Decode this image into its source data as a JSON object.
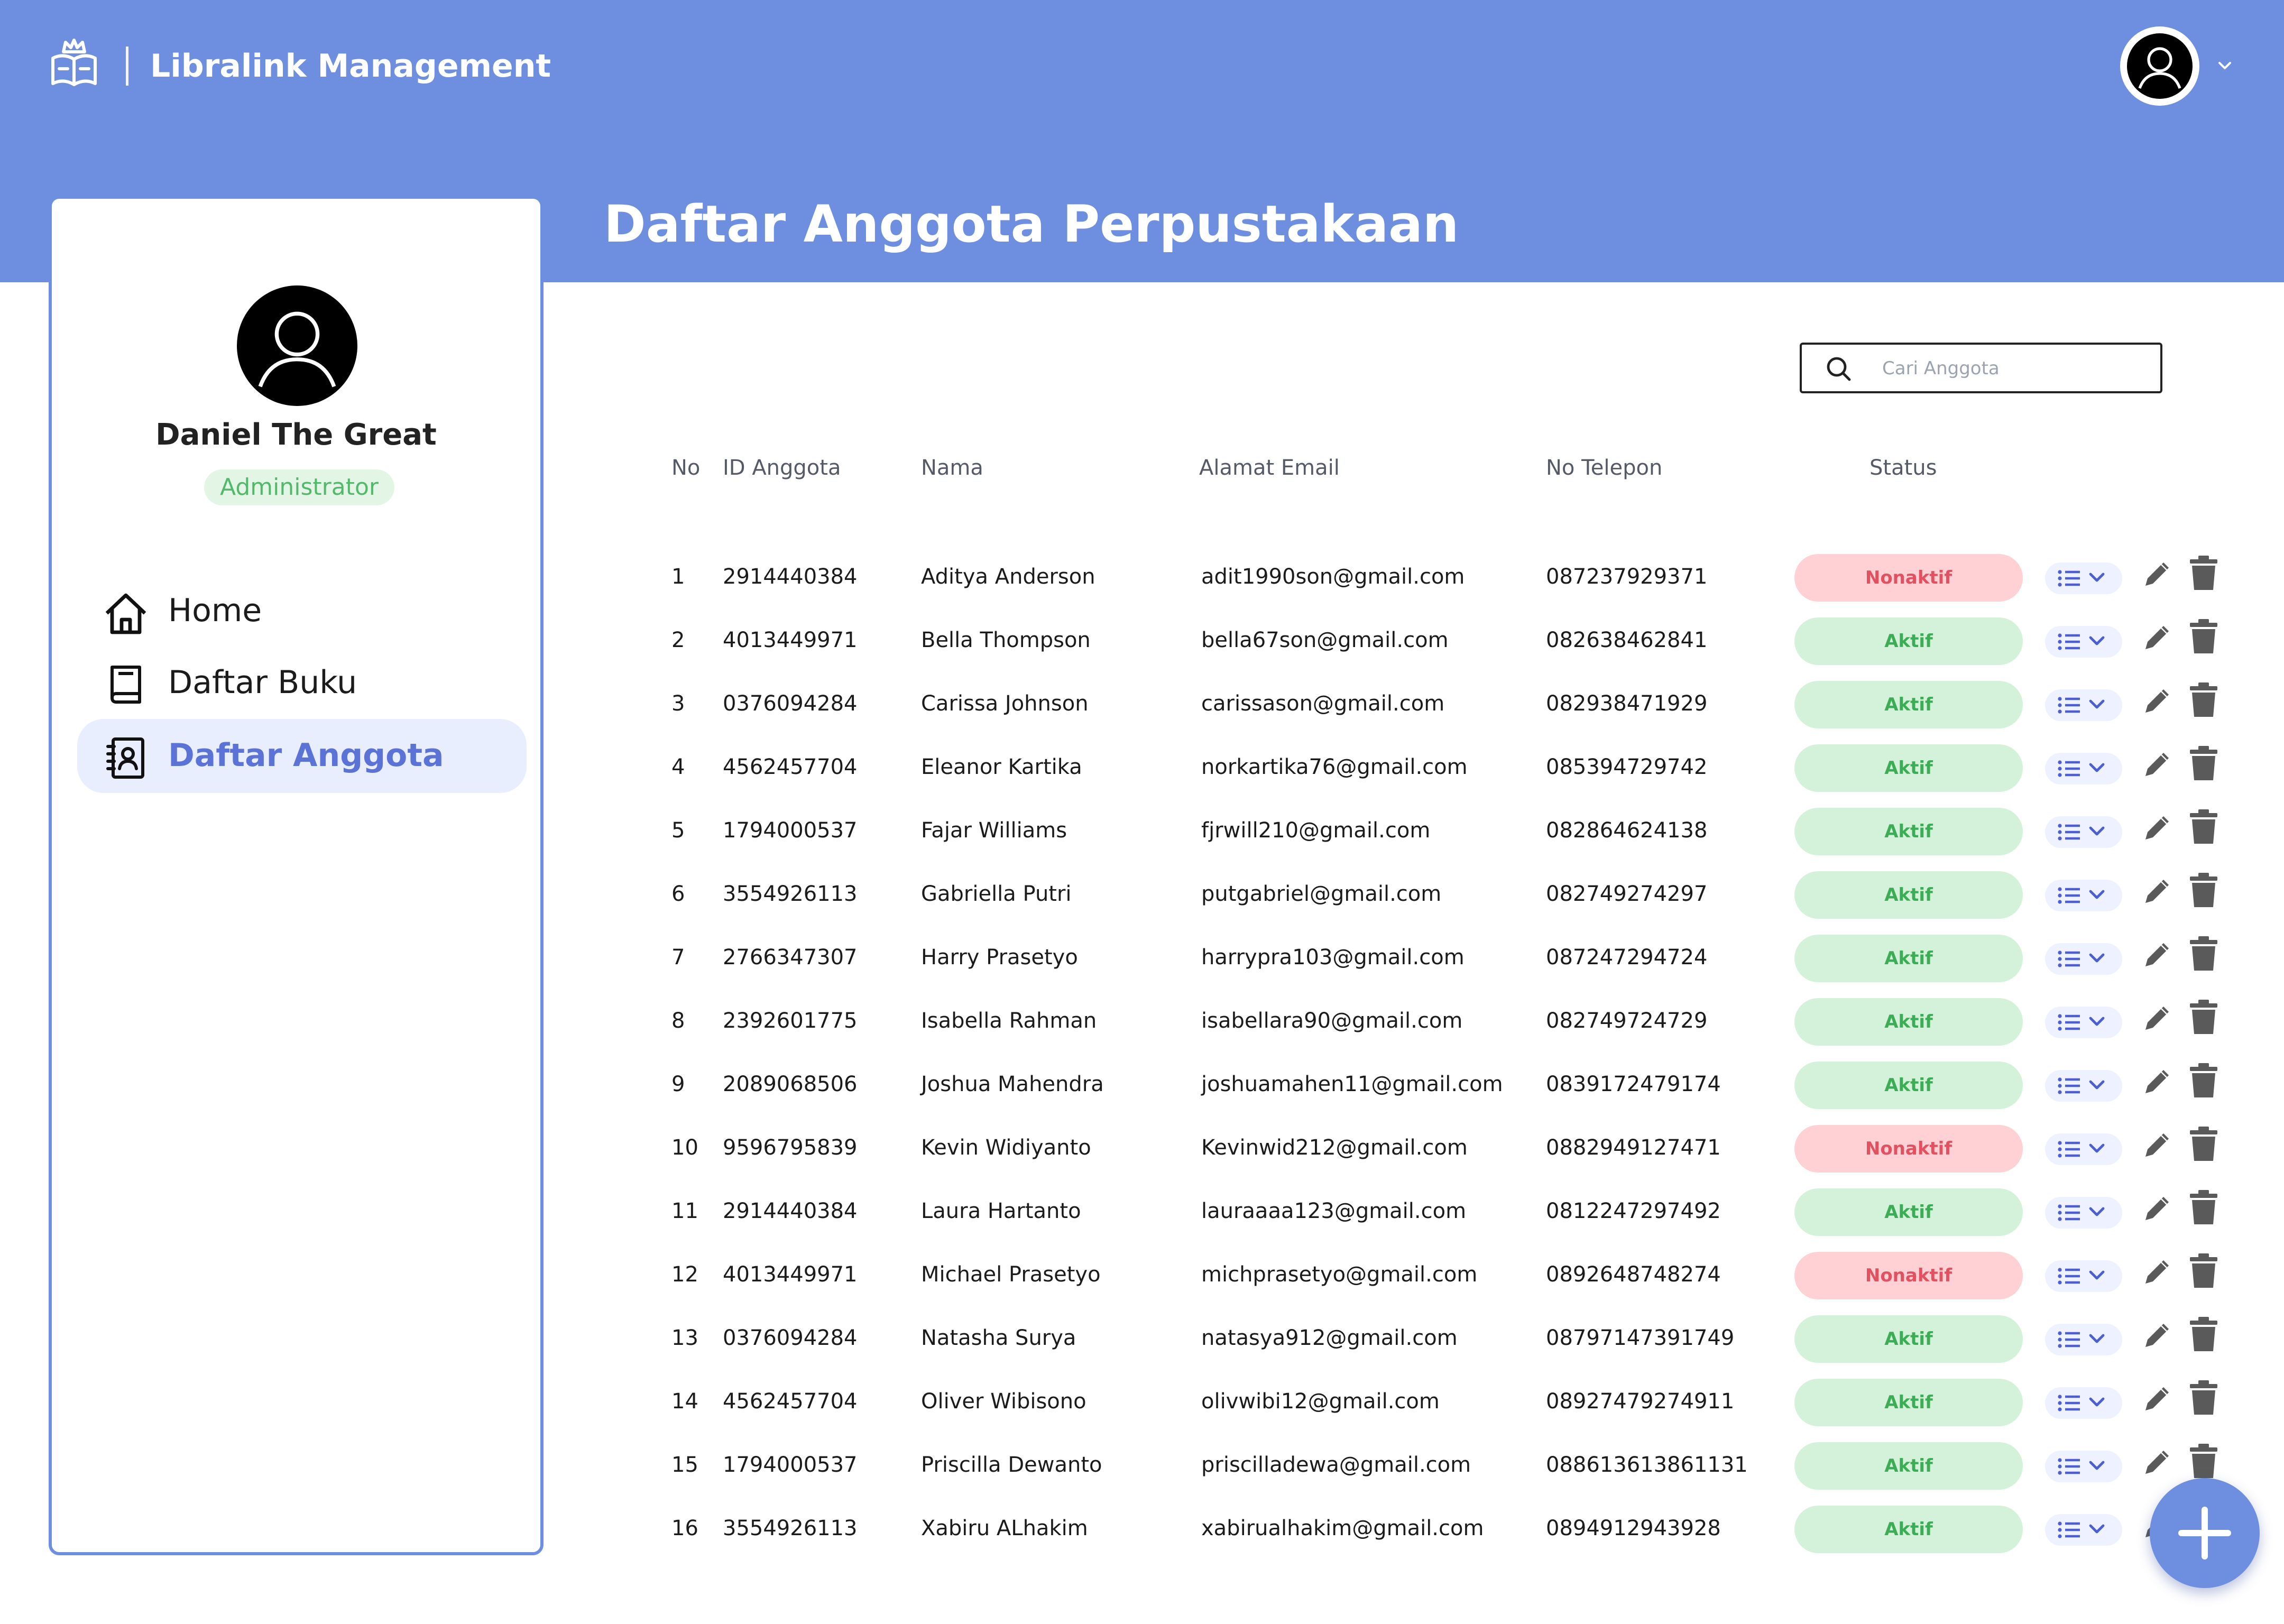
{
  "app": {
    "title": "Libralink Management"
  },
  "page": {
    "title": "Daftar Anggota Perpustakaan"
  },
  "user": {
    "name": "Daniel The Great",
    "role": "Administrator"
  },
  "nav": [
    {
      "label": "Home",
      "icon": "home-icon",
      "active": false
    },
    {
      "label": "Daftar Buku",
      "icon": "book-icon",
      "active": false
    },
    {
      "label": "Daftar Anggota",
      "icon": "contacts-icon",
      "active": true
    }
  ],
  "search": {
    "placeholder": "Cari Anggota",
    "value": ""
  },
  "table": {
    "headers": {
      "no": "No",
      "id": "ID Anggota",
      "name": "Nama",
      "email": "Alamat Email",
      "phone": "No Telepon",
      "status": "Status"
    },
    "rows": [
      {
        "no": "1",
        "id": "2914440384",
        "name": "Aditya Anderson",
        "email": "adit1990son@gmail.com",
        "phone": "087237929371",
        "status": "Nonaktif"
      },
      {
        "no": "2",
        "id": "4013449971",
        "name": "Bella Thompson",
        "email": "bella67son@gmail.com",
        "phone": "082638462841",
        "status": "Aktif"
      },
      {
        "no": "3",
        "id": "0376094284",
        "name": "Carissa Johnson",
        "email": "carissason@gmail.com",
        "phone": "082938471929",
        "status": "Aktif"
      },
      {
        "no": "4",
        "id": "4562457704",
        "name": "Eleanor Kartika",
        "email": "norkartika76@gmail.com",
        "phone": "085394729742",
        "status": "Aktif"
      },
      {
        "no": "5",
        "id": "1794000537",
        "name": "Fajar Williams",
        "email": "fjrwill210@gmail.com",
        "phone": "082864624138",
        "status": "Aktif"
      },
      {
        "no": "6",
        "id": "3554926113",
        "name": "Gabriella Putri",
        "email": "putgabriel@gmail.com",
        "phone": "082749274297",
        "status": "Aktif"
      },
      {
        "no": "7",
        "id": "2766347307",
        "name": "Harry Prasetyo",
        "email": "harrypra103@gmail.com",
        "phone": "087247294724",
        "status": "Aktif"
      },
      {
        "no": "8",
        "id": "2392601775",
        "name": "Isabella Rahman",
        "email": "isabellara90@gmail.com",
        "phone": "082749724729",
        "status": "Aktif"
      },
      {
        "no": "9",
        "id": "2089068506",
        "name": "Joshua Mahendra",
        "email": "joshuamahen11@gmail.com",
        "phone": "0839172479174",
        "status": "Aktif"
      },
      {
        "no": "10",
        "id": "9596795839",
        "name": "Kevin Widiyanto",
        "email": "Kevinwid212@gmail.com",
        "phone": "0882949127471",
        "status": "Nonaktif"
      },
      {
        "no": "11",
        "id": "2914440384",
        "name": "Laura Hartanto",
        "email": "lauraaaa123@gmail.com",
        "phone": "0812247297492",
        "status": "Aktif"
      },
      {
        "no": "12",
        "id": "4013449971",
        "name": "Michael Prasetyo",
        "email": "michprasetyo@gmail.com",
        "phone": "0892648748274",
        "status": "Nonaktif"
      },
      {
        "no": "13",
        "id": "0376094284",
        "name": "Natasha Surya",
        "email": "natasya912@gmail.com",
        "phone": "08797147391749",
        "status": "Aktif"
      },
      {
        "no": "14",
        "id": "4562457704",
        "name": "Oliver Wibisono",
        "email": "olivwibi12@gmail.com",
        "phone": "08927479274911",
        "status": "Aktif"
      },
      {
        "no": "15",
        "id": "1794000537",
        "name": "Priscilla Dewanto",
        "email": "priscilladewa@gmail.com",
        "phone": "088613613861131",
        "status": "Aktif"
      },
      {
        "no": "16",
        "id": "3554926113",
        "name": "Xabiru ALhakim",
        "email": "xabirualhakim@gmail.com",
        "phone": "0894912943928",
        "status": "Aktif"
      }
    ]
  },
  "colors": {
    "header": "#6e8ee0",
    "active_nav_bg": "#e9eeff",
    "active_nav_text": "#5b73d6",
    "aktif_bg": "#d4f2d9",
    "aktif_text": "#3bae55",
    "nonaktif_bg": "#ffd1d5",
    "nonaktif_text": "#e2515f"
  },
  "icons": {
    "logo": "book-crown-logo-icon",
    "search": "search-icon",
    "list": "list-icon",
    "edit": "pencil-icon",
    "delete": "trash-icon",
    "add": "plus-icon",
    "user": "user-avatar-icon",
    "dropdown": "chevron-down-icon"
  }
}
